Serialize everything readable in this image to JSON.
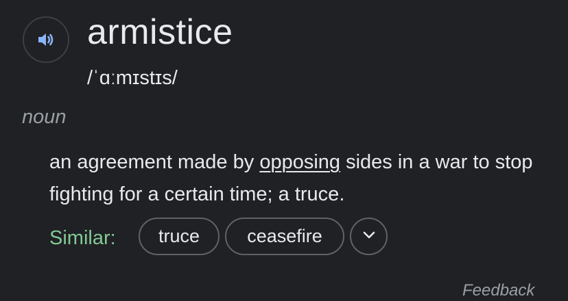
{
  "entry": {
    "word": "armistice",
    "phonetic": "/ˈɑːmɪstɪs/",
    "part_of_speech": "noun",
    "audio_icon": "speaker-icon"
  },
  "definition": {
    "before_link": "an agreement made by ",
    "link_text": "opposing",
    "after_link": " sides in a war to stop fighting for a certain time; a truce."
  },
  "similar": {
    "label": "Similar:",
    "chips": [
      "truce",
      "ceasefire"
    ],
    "expand_icon": "chevron-down-icon"
  },
  "footer": {
    "feedback": "Feedback"
  },
  "colors": {
    "background": "#202124",
    "text": "#e8eaed",
    "muted": "#9aa0a6",
    "similar_label": "#81c995",
    "speaker_icon": "#8ab4f8",
    "chip_border": "#5f6368"
  }
}
